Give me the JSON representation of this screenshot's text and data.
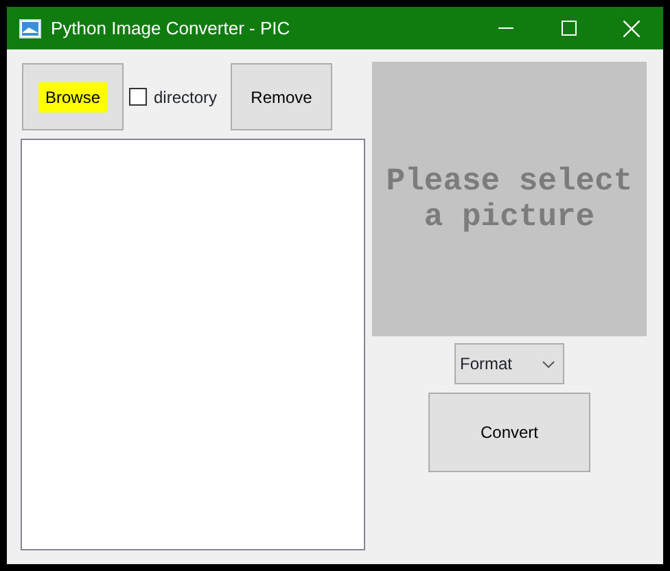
{
  "window": {
    "title": "Python Image Converter - PIC"
  },
  "buttons": [
    {
      "label": "Browse",
      "highlighted": true
    },
    {
      "label": "Remove",
      "highlighted": false
    }
  ],
  "directory_checkbox": {
    "label": "directory",
    "checked": false
  },
  "preview": {
    "text": "Please select a picture"
  },
  "format_dropdown": {
    "value": "Format"
  },
  "convert_button": {
    "label": "Convert"
  }
}
